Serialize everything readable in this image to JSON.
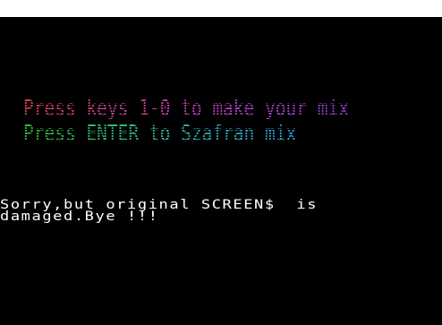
{
  "screen": {
    "background": "#000000",
    "menu_line_1": {
      "text": "Press keys 1-0 to make your mix",
      "gradient": [
        "#e0404f",
        "#c040c0",
        "#9a40e0"
      ]
    },
    "menu_line_2": {
      "text": "Press ENTER to Szafran mix",
      "gradient": [
        "#30c030",
        "#30b8a0",
        "#30a0e0"
      ]
    },
    "message": {
      "line_1": "Sorry,but original SCREEN$  is",
      "line_2": "damaged.Bye !!!",
      "color": "#ffffff"
    }
  }
}
